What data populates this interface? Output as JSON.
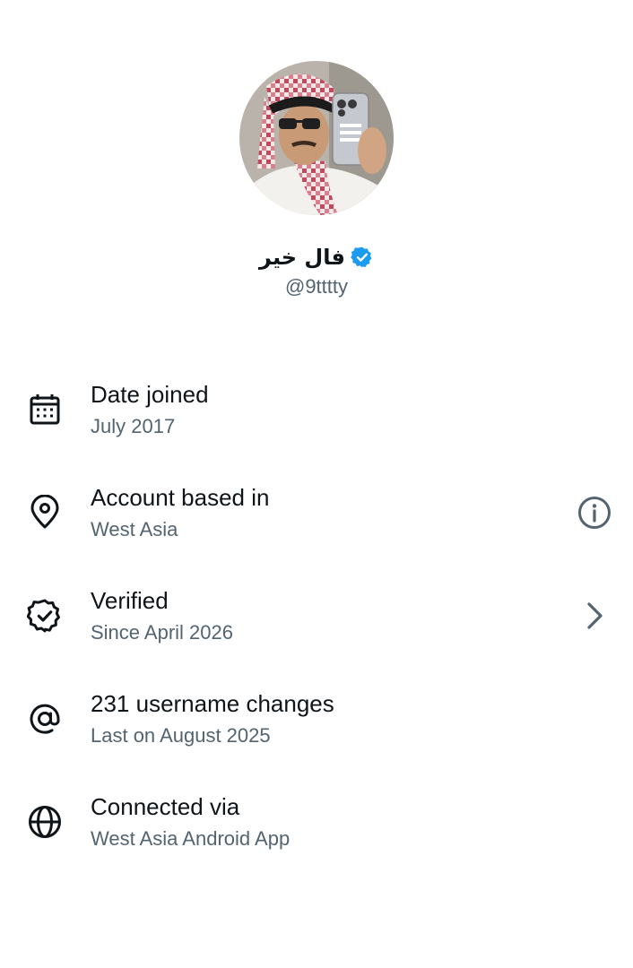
{
  "profile": {
    "display_name": "فال خير",
    "handle": "@9tttty",
    "verified_color": "#1d9bf0"
  },
  "rows": [
    {
      "icon": "calendar-icon",
      "title": "Date joined",
      "subtitle": "July 2017"
    },
    {
      "icon": "location-pin-icon",
      "title": "Account based in",
      "subtitle": "West Asia",
      "action": "info-icon"
    },
    {
      "icon": "verified-badge-icon",
      "title": "Verified",
      "subtitle": "Since April 2026",
      "action": "chevron-right-icon"
    },
    {
      "icon": "at-sign-icon",
      "title": "231 username changes",
      "subtitle": "Last on August 2025"
    },
    {
      "icon": "globe-icon",
      "title": "Connected via",
      "subtitle": "West Asia Android App"
    }
  ],
  "colors": {
    "text_primary": "#0f1419",
    "text_secondary": "#536471",
    "accent": "#1d9bf0"
  }
}
